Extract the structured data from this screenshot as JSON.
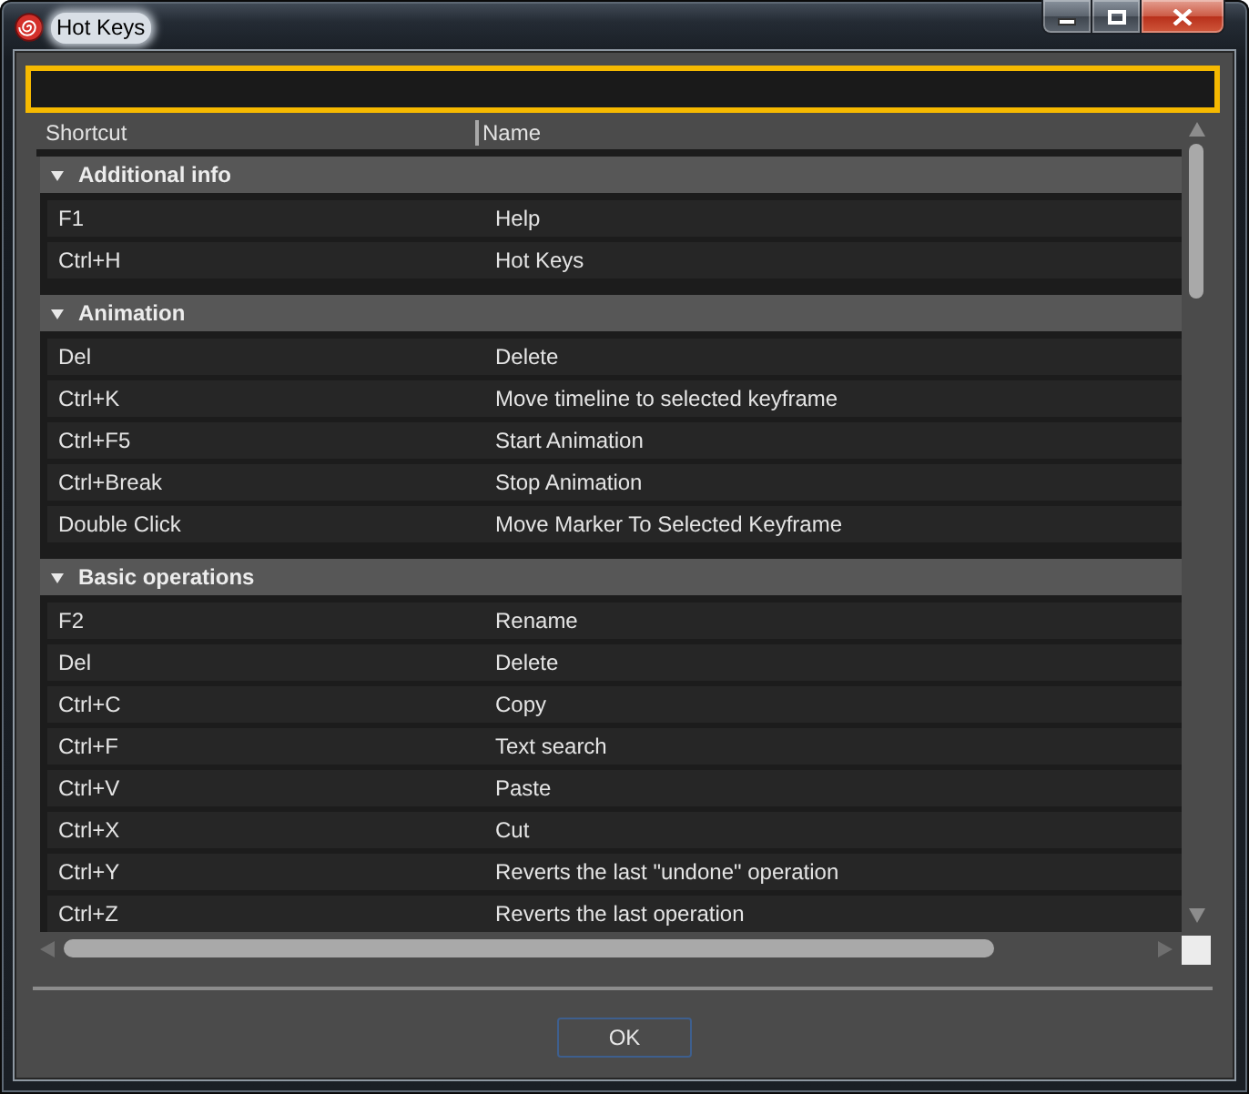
{
  "window": {
    "title": "Hot Keys"
  },
  "input_field": {
    "focused": true
  },
  "table": {
    "columns": [
      "Shortcut",
      "Name"
    ],
    "groups": [
      {
        "title": "Additional info",
        "expanded": true,
        "rows": [
          {
            "shortcut": "F1",
            "name": "Help"
          },
          {
            "shortcut": "Ctrl+H",
            "name": "Hot Keys"
          }
        ]
      },
      {
        "title": "Animation",
        "expanded": true,
        "rows": [
          {
            "shortcut": "Del",
            "name": "Delete"
          },
          {
            "shortcut": "Ctrl+K",
            "name": "Move timeline to selected keyframe"
          },
          {
            "shortcut": "Ctrl+F5",
            "name": "Start Animation"
          },
          {
            "shortcut": "Ctrl+Break",
            "name": "Stop Animation"
          },
          {
            "shortcut": "Double Click",
            "name": "Move Marker To Selected Keyframe"
          }
        ]
      },
      {
        "title": "Basic operations",
        "expanded": true,
        "rows": [
          {
            "shortcut": "F2",
            "name": "Rename"
          },
          {
            "shortcut": "Del",
            "name": "Delete"
          },
          {
            "shortcut": "Ctrl+C",
            "name": "Copy"
          },
          {
            "shortcut": "Ctrl+F",
            "name": "Text search"
          },
          {
            "shortcut": "Ctrl+V",
            "name": "Paste"
          },
          {
            "shortcut": "Ctrl+X",
            "name": "Cut"
          },
          {
            "shortcut": "Ctrl+Y",
            "name": "Reverts the last \"undone\" operation"
          },
          {
            "shortcut": "Ctrl+Z",
            "name": "Reverts the last operation"
          }
        ]
      }
    ]
  },
  "buttons": [
    "OK"
  ]
}
